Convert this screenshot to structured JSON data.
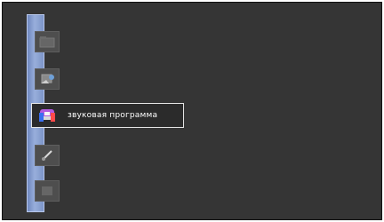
{
  "menu": {
    "items": [
      {
        "id": "item-1",
        "icon": "folder-icon",
        "label": ""
      },
      {
        "id": "item-2",
        "icon": "display-settings-icon",
        "label": ""
      },
      {
        "id": "item-3",
        "icon": "audio-program-icon",
        "label": "звуковая программа",
        "selected": true
      },
      {
        "id": "item-4",
        "icon": "tools-icon",
        "label": ""
      },
      {
        "id": "item-5",
        "icon": "blank-item-icon",
        "label": ""
      }
    ]
  },
  "colors": {
    "background": "#353535",
    "sidebar": "#8aa0d4",
    "selected_border": "#e5e5e5",
    "text": "#ffffff"
  }
}
